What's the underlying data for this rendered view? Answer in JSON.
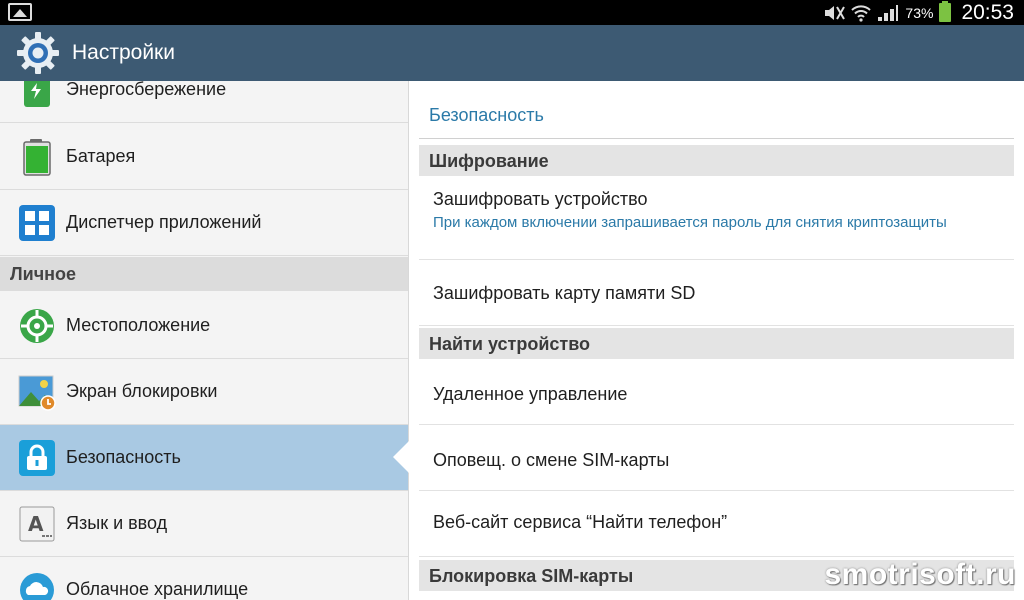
{
  "status_bar": {
    "battery_percent": "73%",
    "time": "20:53"
  },
  "action_bar": {
    "title": "Настройки",
    "icon": "settings-gear-icon"
  },
  "left_panel": {
    "items": [
      {
        "label": "Энергосбережение",
        "icon": "power-saving-icon"
      },
      {
        "label": "Батарея",
        "icon": "battery-icon"
      },
      {
        "label": "Диспетчер приложений",
        "icon": "application-manager-icon"
      }
    ],
    "header_personal": "Личное",
    "personal_items": [
      {
        "label": "Местоположение",
        "icon": "location-icon"
      },
      {
        "label": "Экран блокировки",
        "icon": "lock-screen-icon"
      },
      {
        "label": "Безопасность",
        "icon": "security-lock-icon",
        "selected": true
      },
      {
        "label": "Язык и ввод",
        "icon": "language-input-icon"
      },
      {
        "label": "Облачное хранилище",
        "icon": "cloud-storage-icon"
      }
    ]
  },
  "right_panel": {
    "title": "Безопасность",
    "sections": [
      {
        "header": "Шифрование",
        "rows": [
          {
            "title": "Зашифровать устройство",
            "subtitle": "При каждом включении запрашивается пароль для снятия криптозащиты"
          },
          {
            "title": "Зашифровать карту памяти SD"
          }
        ]
      },
      {
        "header": "Найти устройство",
        "rows": [
          {
            "title": "Удаленное управление"
          },
          {
            "title": "Оповещ. о смене SIM-карты"
          },
          {
            "title": "Веб-сайт сервиса “Найти телефон”"
          }
        ]
      },
      {
        "header": "Блокировка SIM-карты",
        "rows": []
      }
    ]
  },
  "watermark": "smotrisoft.ru",
  "colors": {
    "action_bar": "#3d5a73",
    "selected_item": "#a9c9e3",
    "accent_text": "#2b7aa8",
    "battery": "#7cc242"
  }
}
